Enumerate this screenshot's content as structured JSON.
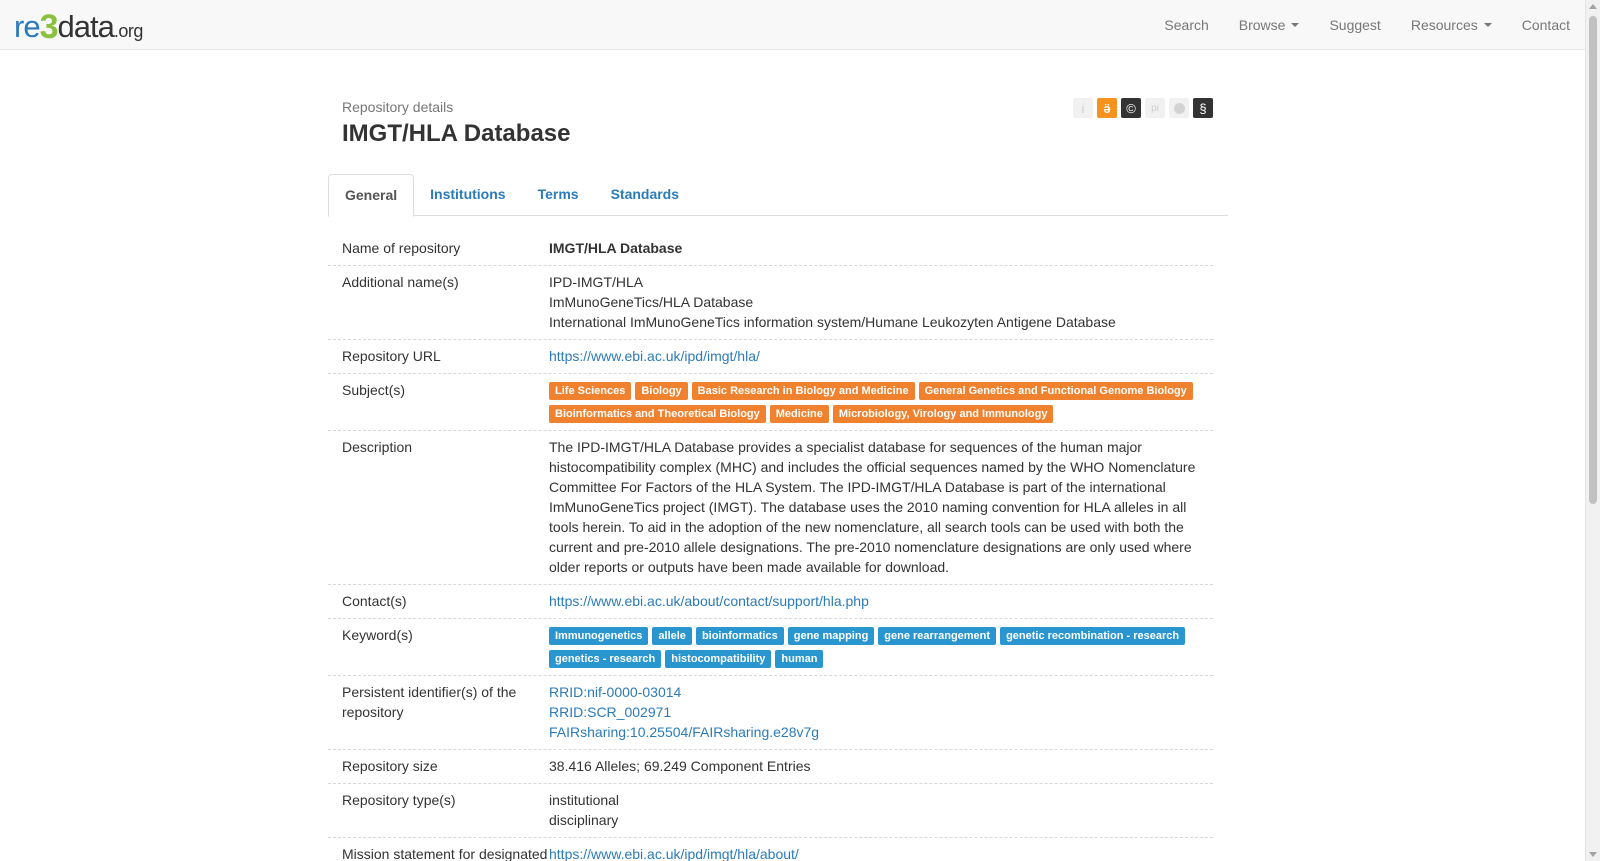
{
  "brand": {
    "re": "re",
    "three": "3",
    "data": "data",
    "org": ".org"
  },
  "nav": {
    "search": "Search",
    "browse": "Browse",
    "suggest": "Suggest",
    "resources": "Resources",
    "contact": "Contact"
  },
  "header": {
    "subtitle": "Repository details",
    "title": "IMGT/HLA Database",
    "icons": [
      {
        "name": "info-icon",
        "glyph": "i"
      },
      {
        "name": "open-access-icon",
        "glyph": "ӛ",
        "color": "#f6921e"
      },
      {
        "name": "copyright-icon",
        "glyph": "©",
        "color": "#333333"
      },
      {
        "name": "pid-icon",
        "glyph": "pi"
      },
      {
        "name": "certificate-icon",
        "glyph": ""
      },
      {
        "name": "policy-icon",
        "glyph": "§",
        "color": "#333333"
      }
    ]
  },
  "tabs": [
    "General",
    "Institutions",
    "Terms",
    "Standards"
  ],
  "details": {
    "name": {
      "label": "Name of repository",
      "value": "IMGT/HLA Database"
    },
    "additional_names": {
      "label": "Additional name(s)",
      "values": [
        "IPD-IMGT/HLA",
        "ImMunoGeneTics/HLA Database",
        "International ImMunoGeneTics information system/Humane Leukozyten Antigene Database"
      ]
    },
    "url": {
      "label": "Repository URL",
      "value": "https://www.ebi.ac.uk/ipd/imgt/hla/"
    },
    "subjects": {
      "label": "Subject(s)",
      "values": [
        "Life Sciences",
        "Biology",
        "Basic Research in Biology and Medicine",
        "General Genetics and Functional Genome Biology",
        "Bioinformatics and Theoretical Biology",
        "Medicine",
        "Microbiology, Virology and Immunology"
      ],
      "color": "#f0812e"
    },
    "description": {
      "label": "Description",
      "value": "The IPD-IMGT/HLA Database provides a specialist database for sequences of the human major histocompatibility complex (MHC) and includes the official sequences named by the WHO Nomenclature Committee For Factors of the HLA System. The IPD-IMGT/HLA Database is part of the international ImMunoGeneTics project (IMGT). The database uses the 2010 naming convention for HLA alleles in all tools herein. To aid in the adoption of the new nomenclature, all search tools can be used with both the current and pre-2010 allele designations. The pre-2010 nomenclature designations are only used where older reports or outputs have been made available for download."
    },
    "contacts": {
      "label": "Contact(s)",
      "value": "https://www.ebi.ac.uk/about/contact/support/hla.php"
    },
    "keywords": {
      "label": "Keyword(s)",
      "values": [
        "Immunogenetics",
        "allele",
        "bioinformatics",
        "gene mapping",
        "gene rearrangement",
        "genetic recombination - research",
        "genetics - research",
        "histocompatibility",
        "human"
      ],
      "color": "#2a96cf"
    },
    "pids": {
      "label": "Persistent identifier(s) of the repository",
      "values": [
        "RRID:nif-0000-03014",
        "RRID:SCR_002971",
        "FAIRsharing:10.25504/FAIRsharing.e28v7g"
      ]
    },
    "size": {
      "label": "Repository size",
      "value": "38.416 Alleles; 69.249 Component Entries"
    },
    "types": {
      "label": "Repository type(s)",
      "values": [
        "institutional",
        "disciplinary"
      ]
    },
    "mission": {
      "label": "Mission statement for designated community",
      "value": "https://www.ebi.ac.uk/ipd/imgt/hla/about/"
    }
  }
}
